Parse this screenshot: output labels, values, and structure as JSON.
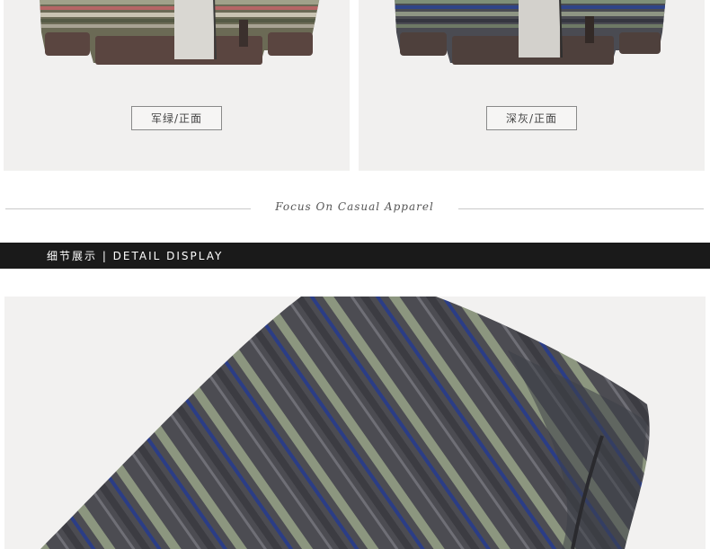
{
  "products": [
    {
      "label": "军绿/正面",
      "color_name": "army-green"
    },
    {
      "label": "深灰/正面",
      "color_name": "dark-gray"
    }
  ],
  "divider": {
    "tagline": "Focus On Casual Apparel"
  },
  "section": {
    "title": "细节展示 | DETAIL DISPLAY"
  },
  "colors": {
    "card_bg": "#f1f0ef",
    "bar_bg": "#1a1a1a",
    "cuff_brown": "#5a4540",
    "stripe_green": "#8d9a7f",
    "stripe_blue": "#2a3f8c",
    "stripe_gray": "#4b4b50"
  }
}
